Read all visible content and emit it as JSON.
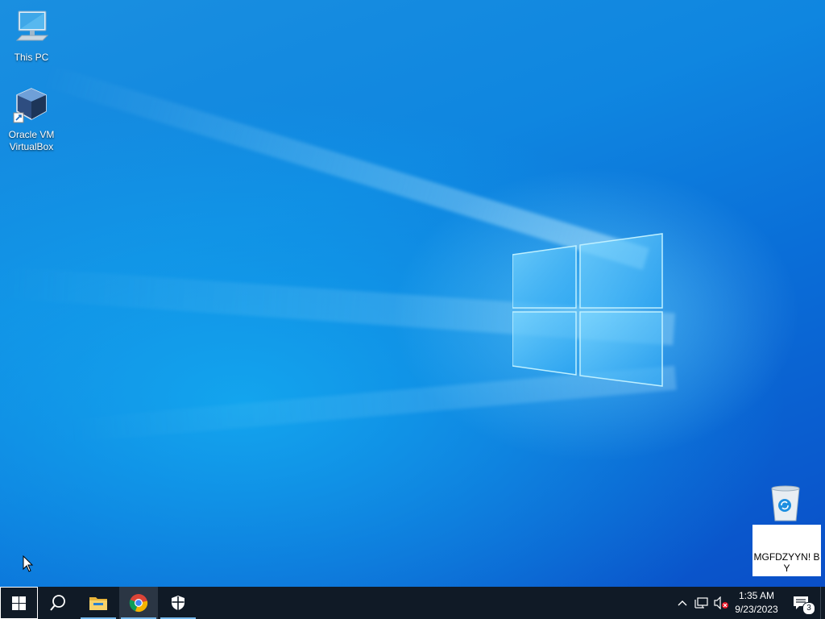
{
  "desktop": {
    "icons": [
      {
        "label": "This PC",
        "icon": "this-pc-icon"
      },
      {
        "label": "Oracle VM VirtualBox",
        "icon": "virtualbox-icon"
      }
    ],
    "recycle_bin": {
      "label": "MGFDZYYN! BY",
      "icon": "recycle-bin-icon"
    }
  },
  "taskbar": {
    "buttons": [
      {
        "name": "start",
        "icon": "windows-start-icon"
      },
      {
        "name": "search",
        "icon": "search-icon"
      },
      {
        "name": "file-explorer",
        "icon": "folder-icon"
      },
      {
        "name": "chrome",
        "icon": "chrome-icon",
        "active": true
      },
      {
        "name": "security",
        "icon": "shield-icon"
      }
    ],
    "tray": {
      "time": "1:35 AM",
      "date": "9/23/2023",
      "notification_count": "3"
    }
  },
  "colors": {
    "taskbar_bg": "#101a26",
    "accent": "#76b9ed",
    "desktop_blue": "#0f86e0"
  }
}
